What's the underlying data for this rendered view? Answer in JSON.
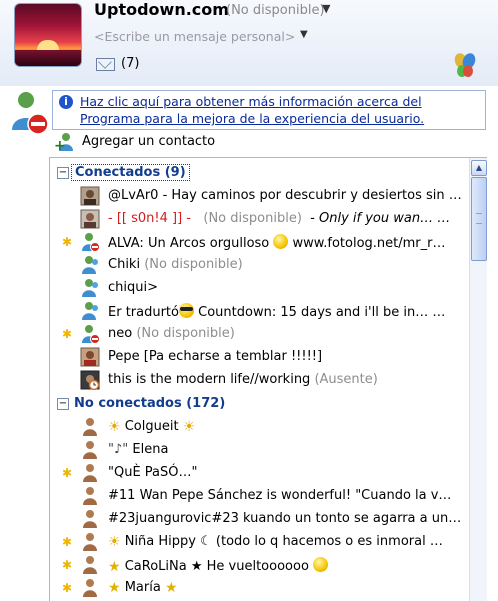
{
  "header": {
    "user_name": "Uptodown.com",
    "status": "(No disponible)",
    "personal_message_placeholder": "<Escribe un mensaje personal>",
    "mail_count": "(7)"
  },
  "banner": {
    "text": "Haz clic aquí para obtener más información acerca del Programa para la mejora de la experiencia del usuario."
  },
  "add_contact_label": "Agregar un contacto",
  "groups": {
    "online": {
      "label": "Conectados (9)",
      "toggle": "−"
    },
    "offline": {
      "label": "No conectados (172)",
      "toggle": "−"
    }
  },
  "online_contacts": [
    {
      "name": "@LvAr0 - Hay caminos por descubrir y desiertos sin …",
      "status": "",
      "star": false,
      "icon": "avatar-picture-icon"
    },
    {
      "name": "- [[ s0n!4 ]] -",
      "status": "(No disponible)",
      "extra": "- Only if you wan… …",
      "star": false,
      "icon": "avatar-picture-icon"
    },
    {
      "name": "ALVA: Un Arcos orgulloso",
      "post": "www.fotolog.net/mr_r…",
      "status": "",
      "star": true,
      "icon": "busy-buddy-icon",
      "emoticon": "smile"
    },
    {
      "name": "Chiki",
      "status": "(No disponible)",
      "star": false,
      "icon": "online-buddy-icon"
    },
    {
      "name": "chiqui>",
      "status": "",
      "star": false,
      "icon": "online-buddy-icon"
    },
    {
      "name": "Er tradurtó",
      "post": "Countdown: 15 days and i'll be in… …",
      "status": "",
      "star": false,
      "icon": "online-buddy-icon",
      "emoticon": "cool"
    },
    {
      "name": "neo",
      "status": "(No disponible)",
      "star": true,
      "icon": "away-buddy-icon"
    },
    {
      "name": "Pepe [Pa echarse a temblar !!!!!]",
      "status": "",
      "star": false,
      "icon": "avatar-picture-icon"
    },
    {
      "name": "this is the modern life//working",
      "status": "(Ausente)",
      "star": false,
      "icon": "away-clock-icon"
    }
  ],
  "offline_contacts": [
    {
      "pre": "☀",
      "name": "Colgueit",
      "post": "☀",
      "star": false
    },
    {
      "pre": "\"♪\"",
      "name": "Elena",
      "post": "",
      "star": false
    },
    {
      "pre": "",
      "name": "\"QuÈ PaSÓ…\"",
      "post": "",
      "star": true
    },
    {
      "pre": "",
      "name": "#11 Wan Pepe Sánchez is wonderful! \"Cuando la v…",
      "post": "",
      "star": false
    },
    {
      "pre": "",
      "name": "#23juangurovic#23 kuando un tonto se agarra a un…",
      "post": "",
      "star": false
    },
    {
      "pre": "☀",
      "name": "Niña Hippy",
      "post": "☾ (todo lo q hacemos o es inmoral …",
      "star": true
    },
    {
      "pre": "★",
      "name": "CaRoLiNa",
      "post": "★ He vueltoooooo",
      "star": true
    },
    {
      "pre": "★",
      "name": "María",
      "post": "★",
      "star": true
    }
  ]
}
